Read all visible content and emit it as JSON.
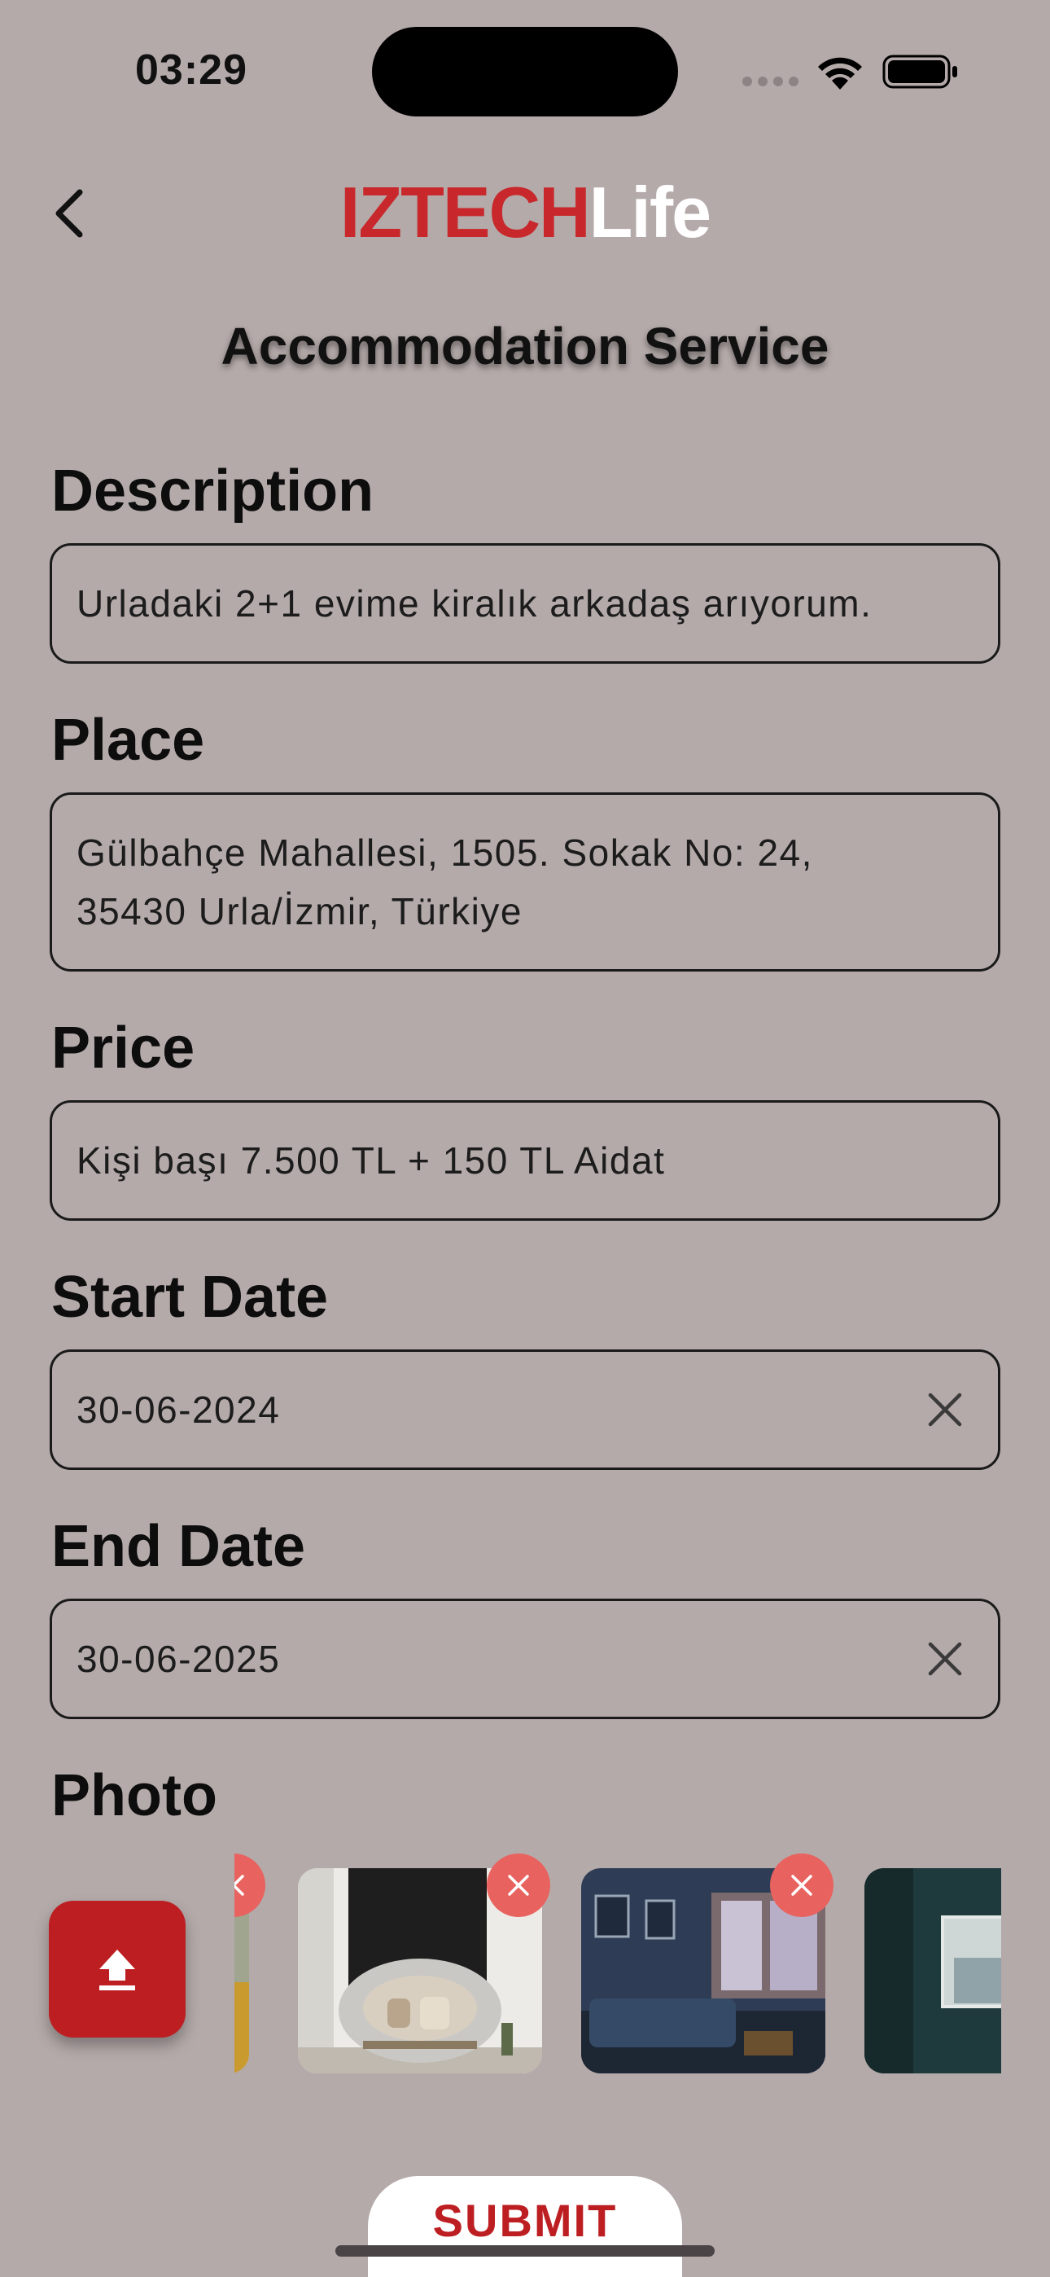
{
  "status_bar": {
    "time": "03:29"
  },
  "header": {
    "logo_part_a": "IZTECH",
    "logo_part_b": "Life",
    "title": "Accommodation Service"
  },
  "form": {
    "description": {
      "label": "Description",
      "value": "Urladaki 2+1 evime kiralık arkadaş arıyorum."
    },
    "place": {
      "label": "Place",
      "line1": "Gülbahçe Mahallesi, 1505. Sokak No: 24,",
      "line2": "35430 Urla/İzmir, Türkiye"
    },
    "price": {
      "label": "Price",
      "value": "Kişi başı 7.500 TL + 150 TL Aidat"
    },
    "start_date": {
      "label": "Start Date",
      "value": "30-06-2024"
    },
    "end_date": {
      "label": "End Date",
      "value": "30-06-2025"
    },
    "photo": {
      "label": "Photo"
    }
  },
  "submit_label": "SUBMIT",
  "colors": {
    "brand_red": "#bd1e22",
    "background": "#b4aaa9",
    "remove_badge": "#e8635f"
  }
}
